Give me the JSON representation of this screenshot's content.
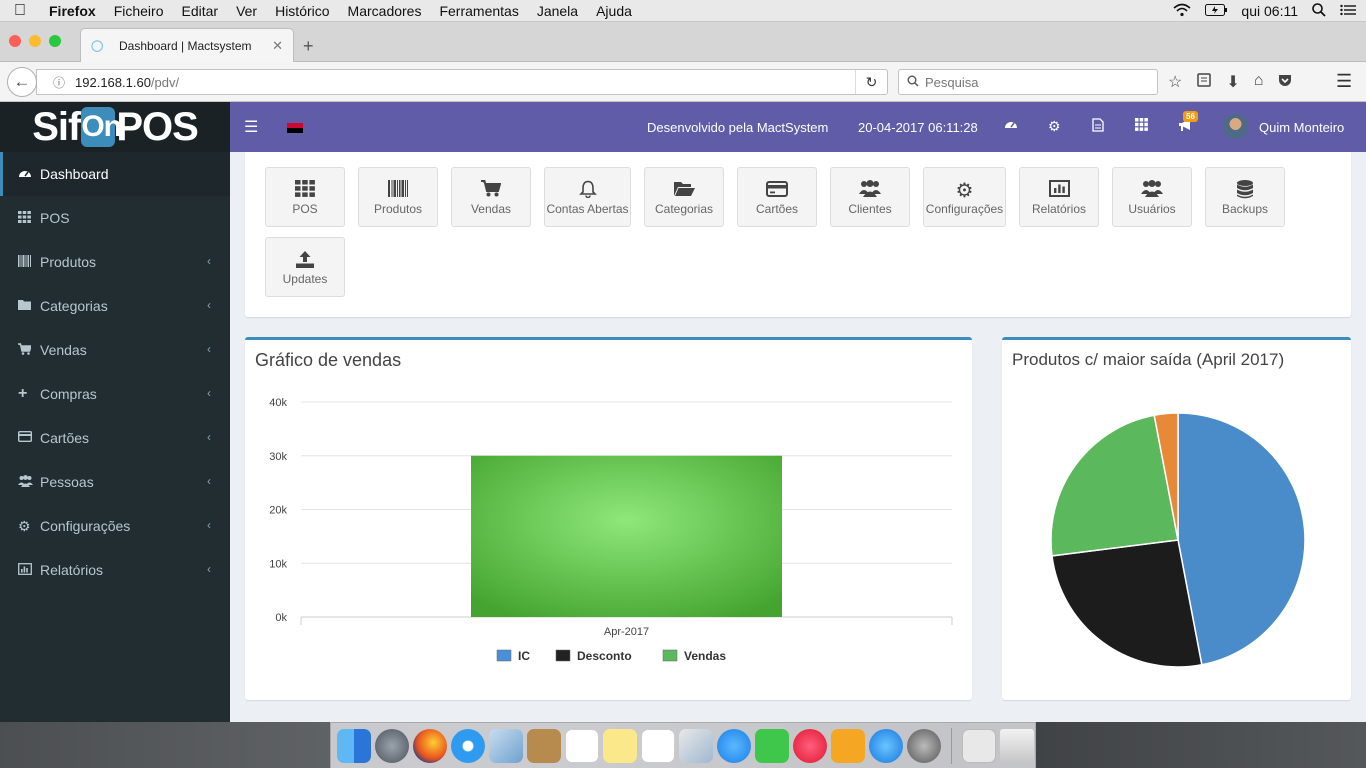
{
  "mac_menu": {
    "app": "Firefox",
    "items": [
      "Ficheiro",
      "Editar",
      "Ver",
      "Histórico",
      "Marcadores",
      "Ferramentas",
      "Janela",
      "Ajuda"
    ],
    "clock": "qui 06:11"
  },
  "browser": {
    "tab_title": "Dashboard | Mactsystem",
    "url_host": "192.168.1.60",
    "url_path": "/pdv/",
    "search_placeholder": "Pesquisa"
  },
  "app": {
    "logo_left": "Sif",
    "logo_mid": "On",
    "logo_right": "POS",
    "developer": "Desenvolvido pela MactSystem",
    "datetime": "20-04-2017 06:11:28",
    "notifications_count": "56",
    "user_name": "Quim Monteiro"
  },
  "sidebar": {
    "items": [
      {
        "label": "Dashboard",
        "icon": "dashboard-icon"
      },
      {
        "label": "POS",
        "icon": "grid-icon"
      },
      {
        "label": "Produtos",
        "icon": "barcode-icon"
      },
      {
        "label": "Categorias",
        "icon": "folder-icon"
      },
      {
        "label": "Vendas",
        "icon": "cart-icon"
      },
      {
        "label": "Compras",
        "icon": "plus-icon"
      },
      {
        "label": "Cartões",
        "icon": "credit-card-icon"
      },
      {
        "label": "Pessoas",
        "icon": "users-icon"
      },
      {
        "label": "Configurações",
        "icon": "gears-icon"
      },
      {
        "label": "Relatórios",
        "icon": "bar-chart-icon"
      }
    ]
  },
  "tiles": [
    {
      "label": "POS",
      "icon": "grid-icon"
    },
    {
      "label": "Produtos",
      "icon": "barcode-icon"
    },
    {
      "label": "Vendas",
      "icon": "cart-icon"
    },
    {
      "label": "Contas Abertas",
      "icon": "bell-icon"
    },
    {
      "label": "Categorias",
      "icon": "folder-open-icon"
    },
    {
      "label": "Cartões",
      "icon": "credit-card-icon"
    },
    {
      "label": "Clientes",
      "icon": "users-icon"
    },
    {
      "label": "Configurações",
      "icon": "gears-icon"
    },
    {
      "label": "Relatórios",
      "icon": "bar-chart-icon"
    },
    {
      "label": "Usuários",
      "icon": "users-icon"
    },
    {
      "label": "Backups",
      "icon": "database-icon"
    },
    {
      "label": "Updates",
      "icon": "upload-icon"
    }
  ],
  "sales_chart": {
    "title": "Gráfico de vendas"
  },
  "pie_chart": {
    "title": "Produtos c/ maior saída (April 2017)"
  },
  "chart_data": [
    {
      "type": "bar",
      "title": "Gráfico de vendas",
      "categories": [
        "Apr-2017"
      ],
      "series": [
        {
          "name": "IC",
          "values": [
            0
          ],
          "color": "#4a90d9"
        },
        {
          "name": "Desconto",
          "values": [
            0
          ],
          "color": "#222222"
        },
        {
          "name": "Vendas",
          "values": [
            30000
          ],
          "color": "#5cb85c"
        }
      ],
      "yticks": [
        "0k",
        "10k",
        "20k",
        "30k",
        "40k"
      ],
      "ylim": [
        0,
        40000
      ],
      "grid": true,
      "legend": "bottom"
    },
    {
      "type": "pie",
      "title": "Produtos c/ maior saída (April 2017)",
      "slices": [
        {
          "value": 47,
          "color": "#4a8bc9"
        },
        {
          "value": 26,
          "color": "#1c1c1c"
        },
        {
          "value": 24,
          "color": "#5cb85c"
        },
        {
          "value": 3,
          "color": "#e8893a"
        }
      ]
    }
  ]
}
